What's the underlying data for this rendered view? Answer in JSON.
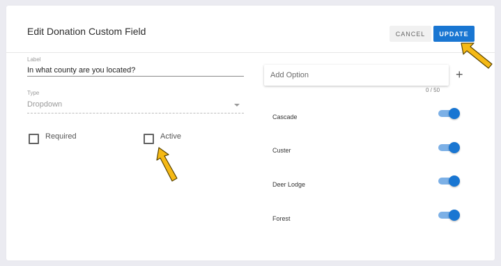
{
  "dialog": {
    "title": "Edit Donation Custom Field",
    "cancel_label": "CANCEL",
    "update_label": "UPDATE"
  },
  "label_field": {
    "label": "Label",
    "value": "In what county are you located?"
  },
  "type_field": {
    "label": "Type",
    "value": "Dropdown"
  },
  "checkboxes": {
    "required": {
      "label": "Required",
      "checked": false
    },
    "active": {
      "label": "Active",
      "checked": false
    }
  },
  "options_panel": {
    "add_option_placeholder": "Add Option",
    "counter": "0 / 50",
    "options": [
      {
        "label": "Cascade",
        "enabled": true
      },
      {
        "label": "Custer",
        "enabled": true
      },
      {
        "label": "Deer Lodge",
        "enabled": true
      },
      {
        "label": "Forest",
        "enabled": true
      }
    ]
  },
  "colors": {
    "accent": "#1976d2",
    "toggle_track": "#7cb0e6",
    "annotation_arrow": "#f5b915"
  },
  "icons": [
    "plus-icon",
    "dropdown-caret-icon",
    "annotation-arrow-icon"
  ]
}
